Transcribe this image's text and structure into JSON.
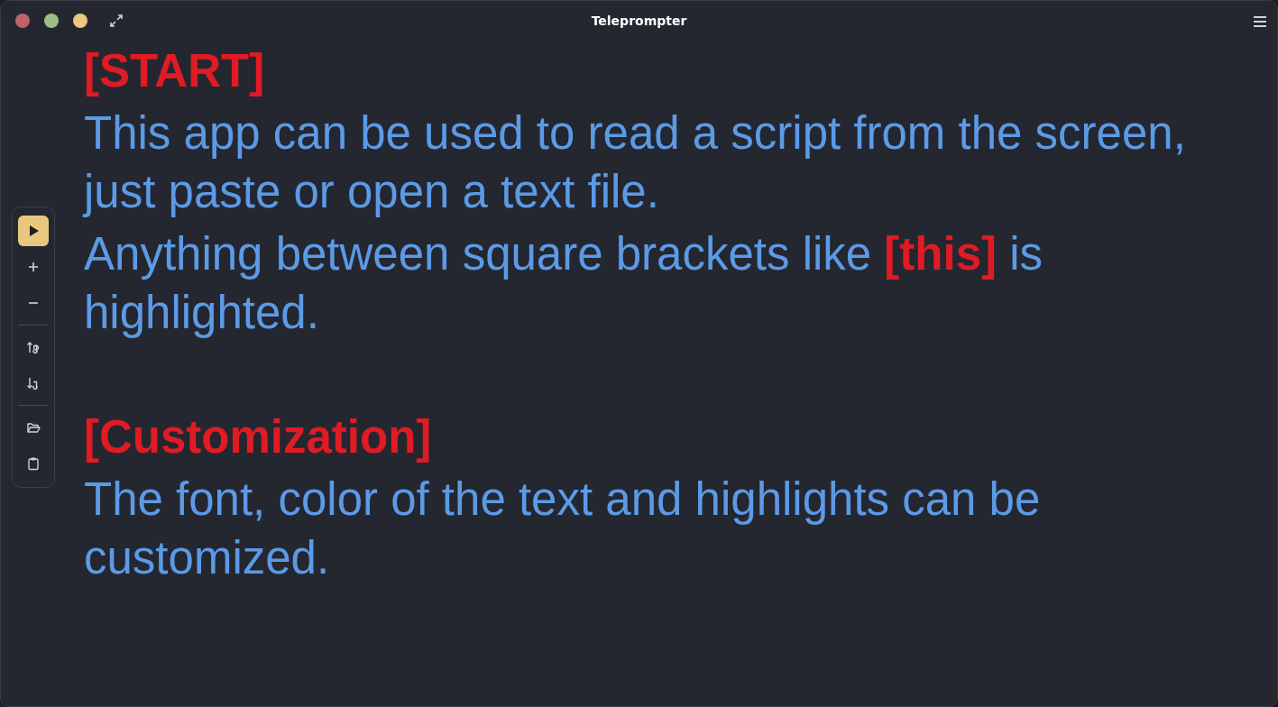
{
  "window": {
    "title": "Teleprompter"
  },
  "toolbar": {
    "groups": [
      [
        {
          "kind": "play",
          "highlighted": true
        },
        {
          "kind": "zoom-in",
          "highlighted": false
        },
        {
          "kind": "zoom-out",
          "highlighted": false
        }
      ],
      [
        {
          "kind": "text-up",
          "highlighted": false
        },
        {
          "kind": "text-down",
          "highlighted": false
        }
      ],
      [
        {
          "kind": "open",
          "highlighted": false
        },
        {
          "kind": "paste",
          "highlighted": false
        }
      ]
    ]
  },
  "script": [
    {
      "kind": "heading",
      "segments": [
        {
          "text": "[START]",
          "highlight": true
        }
      ]
    },
    {
      "kind": "paragraph",
      "segments": [
        {
          "text": "This app can be used to read a script from the screen, just paste or open a text file.",
          "highlight": false
        }
      ]
    },
    {
      "kind": "paragraph",
      "segments": [
        {
          "text": "Anything between square brackets like ",
          "highlight": false
        },
        {
          "text": "[this]",
          "highlight": true
        },
        {
          "text": " is highlighted.",
          "highlight": false
        }
      ]
    },
    {
      "kind": "blank"
    },
    {
      "kind": "heading",
      "segments": [
        {
          "text": "[Customization]",
          "highlight": true
        }
      ]
    },
    {
      "kind": "paragraph",
      "segments": [
        {
          "text": "The font, color of the text and highlights can be customized.",
          "highlight": false
        }
      ]
    }
  ]
}
